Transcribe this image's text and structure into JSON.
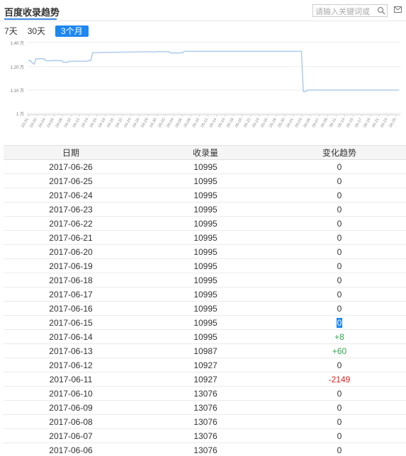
{
  "header": {
    "title": "百度收录趋势",
    "search_placeholder": "请输入关键词或"
  },
  "tabs": [
    {
      "label": "7天",
      "active": false
    },
    {
      "label": "30天",
      "active": false
    },
    {
      "label": "3个月",
      "active": true
    }
  ],
  "chart_data": {
    "type": "line",
    "color": "#a8c8ea",
    "y_ticks": [
      "1.40 万",
      "1.20 万",
      "1.10 万",
      "1 万"
    ],
    "y_tick_values": [
      14000,
      12000,
      11000,
      10000
    ],
    "ylim": [
      10000,
      14000
    ],
    "x_tick_labels": [
      "03-31",
      "04-02",
      "04-04",
      "04-06",
      "04-08",
      "04-10",
      "04-12",
      "04-14",
      "04-16",
      "04-18",
      "04-20",
      "04-22",
      "04-24",
      "04-26",
      "04-28",
      "04-30",
      "05-02",
      "05-04",
      "05-06",
      "05-08",
      "05-10",
      "05-12",
      "05-14",
      "05-16",
      "05-18",
      "05-20",
      "05-22",
      "05-24",
      "05-26",
      "05-28",
      "05-30",
      "06-01",
      "06-03",
      "06-05",
      "06-07",
      "06-09",
      "06-11",
      "06-13",
      "06-15",
      "06-17",
      "06-19",
      "06-21",
      "06-23",
      "06-25"
    ],
    "series": [
      {
        "values": [
          12500,
          12500,
          12300,
          12200,
          12650,
          12650,
          12650,
          12650,
          12650,
          12480,
          12480,
          12480,
          12500,
          12500,
          12500,
          12500,
          12500,
          12500,
          12350,
          12350,
          12350,
          12450,
          12450,
          12450,
          12450,
          12450,
          12450,
          12450,
          12450,
          12450,
          12450,
          12500,
          12500,
          13150,
          13150,
          13150,
          13150,
          13160,
          13160,
          13170,
          13170,
          13170,
          13180,
          13180,
          13190,
          13190,
          13190,
          13200,
          13200,
          13200,
          13200,
          13210,
          13210,
          13210,
          13210,
          13220,
          13220,
          13220,
          13220,
          13230,
          13230,
          13230,
          13230,
          13220,
          13220,
          13220,
          13240,
          13240,
          13240,
          13240,
          13240,
          13240,
          13240,
          13130,
          13130,
          13130,
          13130,
          13130,
          13140,
          13140,
          13270,
          13270,
          13270,
          13270,
          13270,
          13270,
          13270,
          13270,
          13270,
          13270,
          13270,
          13270,
          13270,
          13270,
          13270,
          13270,
          13270,
          13270,
          13270,
          13270,
          13270,
          13270,
          13270,
          13270,
          13270,
          13270,
          13270,
          13270,
          13270,
          13270,
          13270,
          13270,
          13270,
          13270,
          13270,
          13270,
          13270,
          13270,
          13270,
          13270,
          13270,
          13270,
          13270,
          13270,
          13270,
          13270,
          13270,
          13270,
          13270,
          13270,
          13270,
          13270,
          13270,
          13270,
          13270,
          13270,
          13270,
          13270,
          13270,
          13270,
          13270,
          10927,
          10927,
          10987,
          10995,
          10995,
          10995,
          10995,
          10995,
          10995,
          10995,
          10995,
          10995,
          10995,
          10995,
          10995,
          10995,
          10995,
          10995,
          10995,
          10995,
          10995,
          10995,
          10995,
          10995,
          10995,
          10995,
          10995,
          10995,
          10995,
          10995,
          10995,
          10995,
          10995,
          10995,
          10995,
          10995,
          10995,
          10995,
          10995,
          10995,
          10995,
          10995,
          10995,
          10995,
          10995,
          10995,
          10995,
          10995,
          10995,
          10995
        ]
      }
    ]
  },
  "table": {
    "headers": [
      "日期",
      "收录量",
      "变化趋势"
    ],
    "rows": [
      [
        "2017-06-26",
        "10995",
        "0"
      ],
      [
        "2017-06-25",
        "10995",
        "0"
      ],
      [
        "2017-06-24",
        "10995",
        "0"
      ],
      [
        "2017-06-23",
        "10995",
        "0"
      ],
      [
        "2017-06-22",
        "10995",
        "0"
      ],
      [
        "2017-06-21",
        "10995",
        "0"
      ],
      [
        "2017-06-20",
        "10995",
        "0"
      ],
      [
        "2017-06-19",
        "10995",
        "0"
      ],
      [
        "2017-06-18",
        "10995",
        "0"
      ],
      [
        "2017-06-17",
        "10995",
        "0"
      ],
      [
        "2017-06-16",
        "10995",
        "0"
      ],
      [
        "2017-06-15",
        "10995",
        "0"
      ],
      [
        "2017-06-14",
        "10995",
        "+8"
      ],
      [
        "2017-06-13",
        "10987",
        "+60"
      ],
      [
        "2017-06-12",
        "10927",
        "0"
      ],
      [
        "2017-06-11",
        "10927",
        "-2149"
      ],
      [
        "2017-06-10",
        "13076",
        "0"
      ],
      [
        "2017-06-09",
        "13076",
        "0"
      ],
      [
        "2017-06-08",
        "13076",
        "0"
      ],
      [
        "2017-06-07",
        "13076",
        "0"
      ],
      [
        "2017-06-06",
        "13076",
        "0"
      ]
    ],
    "selected_row": 11
  }
}
